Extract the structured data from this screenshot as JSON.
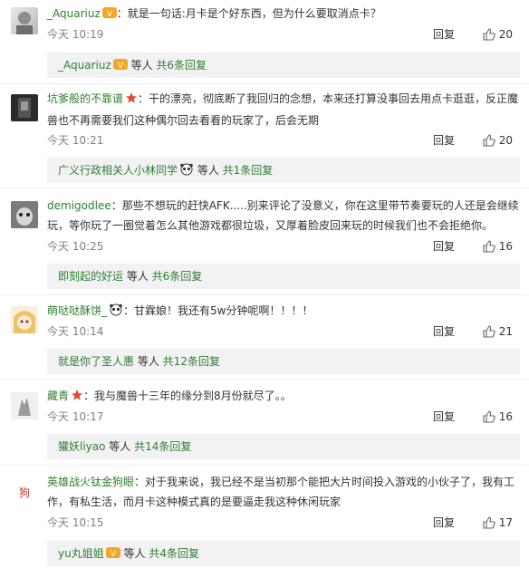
{
  "comments": [
    {
      "user": "_Aquariuz",
      "text": "就是一句话:月卡是个好东西，但为什么要取消点卡？",
      "text2": "",
      "time": "今天 10:19",
      "reply": "回复",
      "likes": "20",
      "sub_user": "_Aquariuz",
      "sub_rest": " 等人",
      "sub_count": "共6条回复"
    },
    {
      "user": "坑爹般的不靠谱",
      "text": "干的漂亮，彻底断了我回归的念想，本来还打算没事回去用点卡逛逛，反正魔",
      "text2": "兽也不再需要我们这种偶尔回去看看的玩家了，后会无期",
      "time": "今天 10:21",
      "reply": "回复",
      "likes": "20",
      "sub_user": "广义行政相关人小林同学",
      "sub_rest": " 等人",
      "sub_count": "共1条回复"
    },
    {
      "user": "demigodlee",
      "text": "那些不想玩的赶快AFK.....别来评论了没意义，你在这里带节奏要玩的人还是会继续",
      "text2": "玩，等你玩了一圈觉着怎么其他游戏都很垃圾，又厚着脸皮回来玩的时候我们也不会拒绝你。",
      "time": "今天 10:25",
      "reply": "回复",
      "likes": "16",
      "sub_user": "即刻起的好运",
      "sub_rest": " 等人",
      "sub_count": "共6条回复"
    },
    {
      "user": "萌哒哒酥饼_",
      "text": "甘霖娘！我还有5w分钟呢啊！！！！",
      "text2": "",
      "time": "今天 10:14",
      "reply": "回复",
      "likes": "21",
      "sub_user": "就是你了圣人惠",
      "sub_rest": " 等人",
      "sub_count": "共12条回复"
    },
    {
      "user": "藏青",
      "text": "我与魔兽十三年的缘分到8月份就尽了。。",
      "text2": "",
      "time": "今天 10:17",
      "reply": "回复",
      "likes": "16",
      "sub_user": "獾妖liyao",
      "sub_rest": " 等人",
      "sub_count": "共14条回复"
    },
    {
      "user": "英雄战火钛金狗眼",
      "text": "对于我来说，我已经不是当初那个能把大片时间投入游戏的小伙子了，我有工",
      "text2": "作，有私生活，而月卡这种模式真的是要逼走我这种休闲玩家",
      "time": "今天 10:15",
      "reply": "回复",
      "likes": "17",
      "sub_user": "yu丸姐姐",
      "sub_rest": " 等人",
      "sub_count": "共4条回复"
    }
  ],
  "colors": {
    "username": "#2f7f2f",
    "meta": "#808080",
    "subbox": "#f2f2f5"
  }
}
